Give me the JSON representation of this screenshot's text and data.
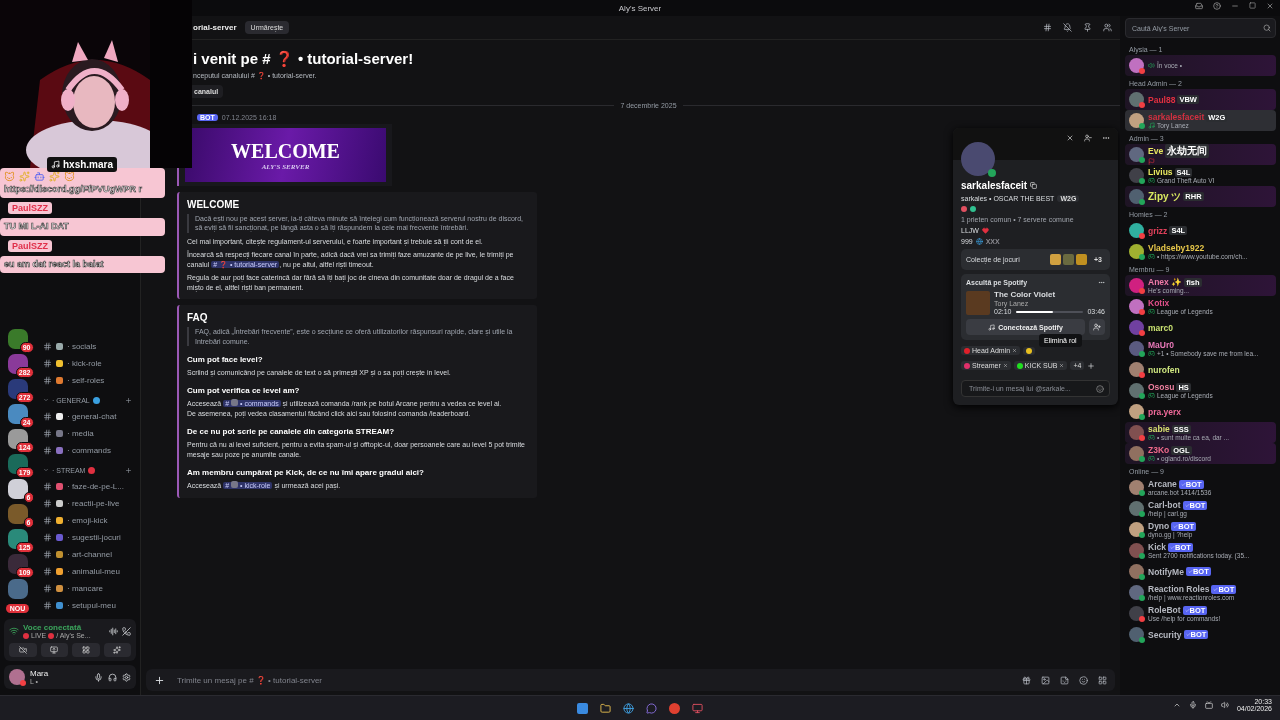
{
  "window": {
    "title": "Aly's Server"
  },
  "overlay": {
    "streamer": "hxsh.mara",
    "chat": [
      {
        "kind": "link",
        "text": "https://discord.gg/FfPVUgWPR r"
      },
      {
        "kind": "message",
        "user": "PaulSZZ",
        "text": "TU MI L-AI DAT"
      },
      {
        "kind": "message",
        "user": "PaulSZZ",
        "text": "eu am dat react la baiat"
      }
    ]
  },
  "servers": [
    {
      "color": "#3a7a2a",
      "badge": "90"
    },
    {
      "color": "#8a3a9a",
      "badge": "282"
    },
    {
      "color": "#2a3a7a",
      "badge": "272"
    },
    {
      "color": "#4a8ac0",
      "badge": "24"
    },
    {
      "color": "#9a9a9a",
      "badge": "124"
    },
    {
      "color": "#1a6a5a",
      "badge": "179"
    },
    {
      "color": "#d0d0d8",
      "badge": "6"
    },
    {
      "color": "#7a5a2a",
      "badge": "6"
    },
    {
      "color": "#2a8a7a",
      "badge": "125"
    },
    {
      "color": "#3a2a3a",
      "badge": "109"
    },
    {
      "color": "#4a6a8a"
    }
  ],
  "new_badge": "NOU",
  "channels": [
    {
      "kind": "channel",
      "name": "· socials"
    },
    {
      "kind": "channel",
      "name": "· kick-role"
    },
    {
      "kind": "channel",
      "name": "· self-roles"
    },
    {
      "kind": "category",
      "name": "· GENERAL"
    },
    {
      "kind": "channel",
      "name": "· general-chat"
    },
    {
      "kind": "channel",
      "name": "· media"
    },
    {
      "kind": "channel",
      "name": "· commands"
    },
    {
      "kind": "category",
      "name": "· STREAM"
    },
    {
      "kind": "channel",
      "name": "· faze-de-pe-L..."
    },
    {
      "kind": "channel",
      "name": "· reactii-pe-live"
    },
    {
      "kind": "channel",
      "name": "· emoji-kick"
    },
    {
      "kind": "channel",
      "name": "· sugestii-jocuri"
    },
    {
      "kind": "channel",
      "name": "· art-channel"
    },
    {
      "kind": "channel",
      "name": "· animalul-meu"
    },
    {
      "kind": "channel",
      "name": "· mancare"
    },
    {
      "kind": "channel",
      "name": "· setupul-meu"
    }
  ],
  "voice": {
    "status": "Voce conectată",
    "live": "LIVE",
    "channel": "/ Aly's Se..."
  },
  "user": {
    "name": "Mara",
    "status": "L •"
  },
  "header": {
    "channel": "orial-server",
    "follow": "Urmărește"
  },
  "search": {
    "placeholder": "Caută Aly's Server"
  },
  "welcome": {
    "title_before": "i venit pe #",
    "title_emoji": "❓",
    "title_after": "• tutorial-server!",
    "subtitle": "nceputul canalului # ❓ • tutorial-server.",
    "button": "canalul"
  },
  "date_divider": "7 decembrie 2025",
  "message": {
    "badge": "BOT",
    "time": "07.12.2025 16:18",
    "banner_title": "WELCOME",
    "banner_subtitle": "ALY'S SERVER"
  },
  "embeds": [
    {
      "title": "WELCOME",
      "quote": "Dacă ești nou pe acest server, ia-ți câteva minute să înțelegi cum funcționează serverul nostru de discord, să eviți să fii sancționat, pe lângă asta o să îți răspundem la cele mai frecvente întrebări.",
      "blocks": [
        {
          "kind": "text",
          "lines": [
            [
              {
                "text": "Cel mai important, citește regulament-ul serverului, e foarte important și trebuie să ții cont de el."
              }
            ]
          ]
        },
        {
          "kind": "text",
          "lines": [
            [
              {
                "text": "Încearcă să respecți fiecare canal în parte, adică dacă vrei sa trimiți faze amuzante de pe live, le trimiți pe canalul "
              },
              {
                "hash": "#",
                "emoji": "❓",
                "name": "• tutorial-server"
              },
              {
                "text": ", nu pe altul, altfel riști timeout."
              }
            ]
          ]
        },
        {
          "kind": "text",
          "lines": [
            [
              {
                "text": "Regula de aur poți face caterincă dar fără să îți bați joc de cineva din comunitate doar de dragul de a face mișto de el, altfel riști ban permanent."
              }
            ]
          ]
        }
      ]
    },
    {
      "title": "FAQ",
      "quote": "FAQ, adică „Întrebări frecvente”, este o secțiune ce oferă utilizatorilor răspunsuri rapide, clare și utile la întrebări comune.",
      "blocks": [
        {
          "kind": "question",
          "text": "Cum pot face level?"
        },
        {
          "kind": "text",
          "lines": [
            [
              {
                "text": "Scriind și comunicând pe canalele de text o să primești XP și o sa poți crește in level."
              }
            ]
          ]
        },
        {
          "kind": "question",
          "text": "Cum pot verifica ce level am?"
        },
        {
          "kind": "text",
          "lines": [
            [
              {
                "text": "Accesează "
              },
              {
                "hash": "#",
                "name": "• commands"
              },
              {
                "text": " și utilizează comanda /rank pe botul Arcane pentru a vedea ce level ai."
              }
            ],
            [
              {
                "text": "De asemenea, poți vedea clasamentul făcând click aici sau folosind comanda /leaderboard."
              }
            ]
          ]
        },
        {
          "kind": "question",
          "text": "De ce nu pot scrie pe canalele din categoria STREAM?"
        },
        {
          "kind": "text",
          "lines": [
            [
              {
                "text": "Pentru că nu ai level suficient, pentru a evita spam-ul și offtopic-ul, doar persoanele care au level 5 pot trimite mesaje sau poze pe anumite canale."
              }
            ]
          ]
        },
        {
          "kind": "question",
          "text": "Am membru cumpărat pe Kick, de ce nu îmi apare gradul aici?"
        },
        {
          "kind": "text",
          "lines": [
            [
              {
                "text": "Accesează "
              },
              {
                "hash": "#",
                "name": "• kick-role"
              },
              {
                "text": " și urmează acei pași."
              }
            ]
          ]
        }
      ]
    }
  ],
  "composer": {
    "placeholder": "Trimite un mesaj pe # ❓ • tutorial-server"
  },
  "profile": {
    "display_name": "sarkalesfaceit",
    "username": "sarkales",
    "pronouns": "• OSCAR THE BEST",
    "tag": "W2G",
    "mutual": "1 prieten comun • 7 servere comune",
    "bio": [
      "LLJW",
      "999",
      "XXX"
    ],
    "games_label": "Colecție de jocuri",
    "games_more": "+3",
    "spotify_label": "Ascultă pe Spotify",
    "song": "The Color Violet",
    "artist": "Tory Lanez",
    "elapsed": "02:10",
    "duration": "03:46",
    "level": 0.55,
    "connect": "Conectează Spotify",
    "roles": [
      {
        "name": "Head Admin",
        "color": "#e0202a"
      },
      {
        "color": "#e8c020"
      },
      {
        "name": "Streamer",
        "color": "#e0306a"
      },
      {
        "name": "KICK SUB",
        "color": "#20e020"
      }
    ],
    "roles_more": "+4",
    "tooltip": "Elimină rol",
    "message_placeholder": "Trimite-i un mesaj lui @sarkale..."
  },
  "members": [
    {
      "group": "Alysia — 1",
      "items": [
        {
          "status": "În voce •",
          "kind": "voice",
          "online": false,
          "banner": true,
          "selected": false
        }
      ]
    },
    {
      "group": "Head Admin — 2",
      "items": [
        {
          "name": "Paul88",
          "color": "#e03040",
          "tag": "VBW",
          "bot": false,
          "online": false,
          "banner": true,
          "selected": false
        },
        {
          "name": "sarkalesfaceit",
          "color": "#d03040",
          "tag": "W2G",
          "bot": false,
          "status": "Tory Lanez",
          "kind": "music",
          "online": true,
          "banner": false,
          "selected": true
        }
      ]
    },
    {
      "group": "Admin — 3",
      "items": [
        {
          "name": "Eve",
          "color": "#e8e860",
          "tag": "永劫无间",
          "bot": false,
          "kind": "flag",
          "online": true,
          "banner": true,
          "selected": false
        },
        {
          "name": "Livius",
          "color": "#e8e860",
          "tag": "S4L",
          "bot": false,
          "status": "Grand Theft Auto VI",
          "kind": "game",
          "online": true,
          "banner": false,
          "selected": false
        },
        {
          "name": "Zipy ツ",
          "color": "#d8e860",
          "tag": "RHR",
          "bot": false,
          "online": true,
          "banner": true,
          "selected": false
        }
      ]
    },
    {
      "group": "Homies — 2",
      "items": [
        {
          "name": "grizz",
          "color": "#e0405a",
          "tag": "S4L",
          "bot": false,
          "online": false,
          "banner": false,
          "selected": false
        },
        {
          "name": "Vladseby1922",
          "color": "#e8c84a",
          "status": "• https://www.youtube.com/ch...",
          "kind": "game",
          "online": true,
          "banner": false,
          "selected": false
        }
      ]
    },
    {
      "group": "Membru — 9",
      "items": [
        {
          "name": "Anex ✨",
          "color": "#f07aa8",
          "tag": "fish",
          "bot": false,
          "status": "He's coming...",
          "online": false,
          "banner": true,
          "selected": false
        },
        {
          "name": "Kotix",
          "color": "#e0508a",
          "status": "League of Legends",
          "kind": "game",
          "online": false,
          "banner": false,
          "selected": false
        },
        {
          "name": "marc0",
          "color": "#c8e070",
          "online": false,
          "banner": false,
          "selected": false
        },
        {
          "name": "MaUr0",
          "color": "#e878b8",
          "status": "+1 • Somebody save me from lea...",
          "kind": "game",
          "online": true,
          "banner": false,
          "selected": false
        },
        {
          "name": "nurofen",
          "color": "#d0e880",
          "online": false,
          "banner": false,
          "selected": false
        },
        {
          "name": "Ososu",
          "color": "#f080a0",
          "tag": "HS",
          "bot": false,
          "status": "League of Legends",
          "kind": "game",
          "online": true,
          "banner": false,
          "selected": false
        },
        {
          "name": "pra.yerx",
          "color": "#f06a9a",
          "online": true,
          "banner": false,
          "selected": false
        },
        {
          "name": "sabie",
          "color": "#d8e070",
          "tag": "SSS",
          "bot": false,
          "status": "• sunt multe ca ea, dar ...",
          "kind": "game",
          "online": false,
          "banner": true,
          "selected": false
        },
        {
          "name": "Z3Ko",
          "color": "#f06a8a",
          "tag": "OGL",
          "bot": false,
          "status": "• ogland.ro/discord",
          "kind": "game",
          "online": true,
          "banner": true,
          "selected": false
        }
      ]
    },
    {
      "group": "Online — 9",
      "items": [
        {
          "name": "Arcane",
          "color": "#b5b8c0",
          "tag": "BOT",
          "bot": true,
          "status": "arcane.bot 1414/1536",
          "online": true,
          "banner": false,
          "selected": false
        },
        {
          "name": "Carl-bot",
          "color": "#b5b8c0",
          "tag": "BOT",
          "bot": true,
          "status": "/help | carl.gg",
          "online": true,
          "banner": false,
          "selected": false
        },
        {
          "name": "Dyno",
          "color": "#b5b8c0",
          "tag": "BOT",
          "bot": true,
          "status": "dyno.gg | ?help",
          "online": true,
          "banner": false,
          "selected": false
        },
        {
          "name": "Kick",
          "color": "#b5b8c0",
          "tag": "BOT",
          "bot": true,
          "status": "Sent 2700 notifications today. (35...",
          "online": true,
          "banner": false,
          "selected": false
        },
        {
          "name": "NotifyMe",
          "color": "#b5b8c0",
          "tag": "BOT",
          "bot": true,
          "online": true,
          "banner": false,
          "selected": false
        },
        {
          "name": "Reaction Roles",
          "color": "#b5b8c0",
          "tag": "BOT",
          "bot": true,
          "status": "/help | www.reactionroles.com",
          "online": true,
          "banner": false,
          "selected": false
        },
        {
          "name": "RoleBot",
          "color": "#b5b8c0",
          "tag": "BOT",
          "bot": true,
          "status": "Use /help for commands!",
          "online": false,
          "banner": false,
          "selected": false
        },
        {
          "name": "Security",
          "color": "#b5b8c0",
          "tag": "BOT",
          "bot": true,
          "online": true,
          "banner": false,
          "selected": false
        }
      ]
    }
  ],
  "taskbar": {
    "time": "20:33",
    "date": "04/02/2026"
  }
}
